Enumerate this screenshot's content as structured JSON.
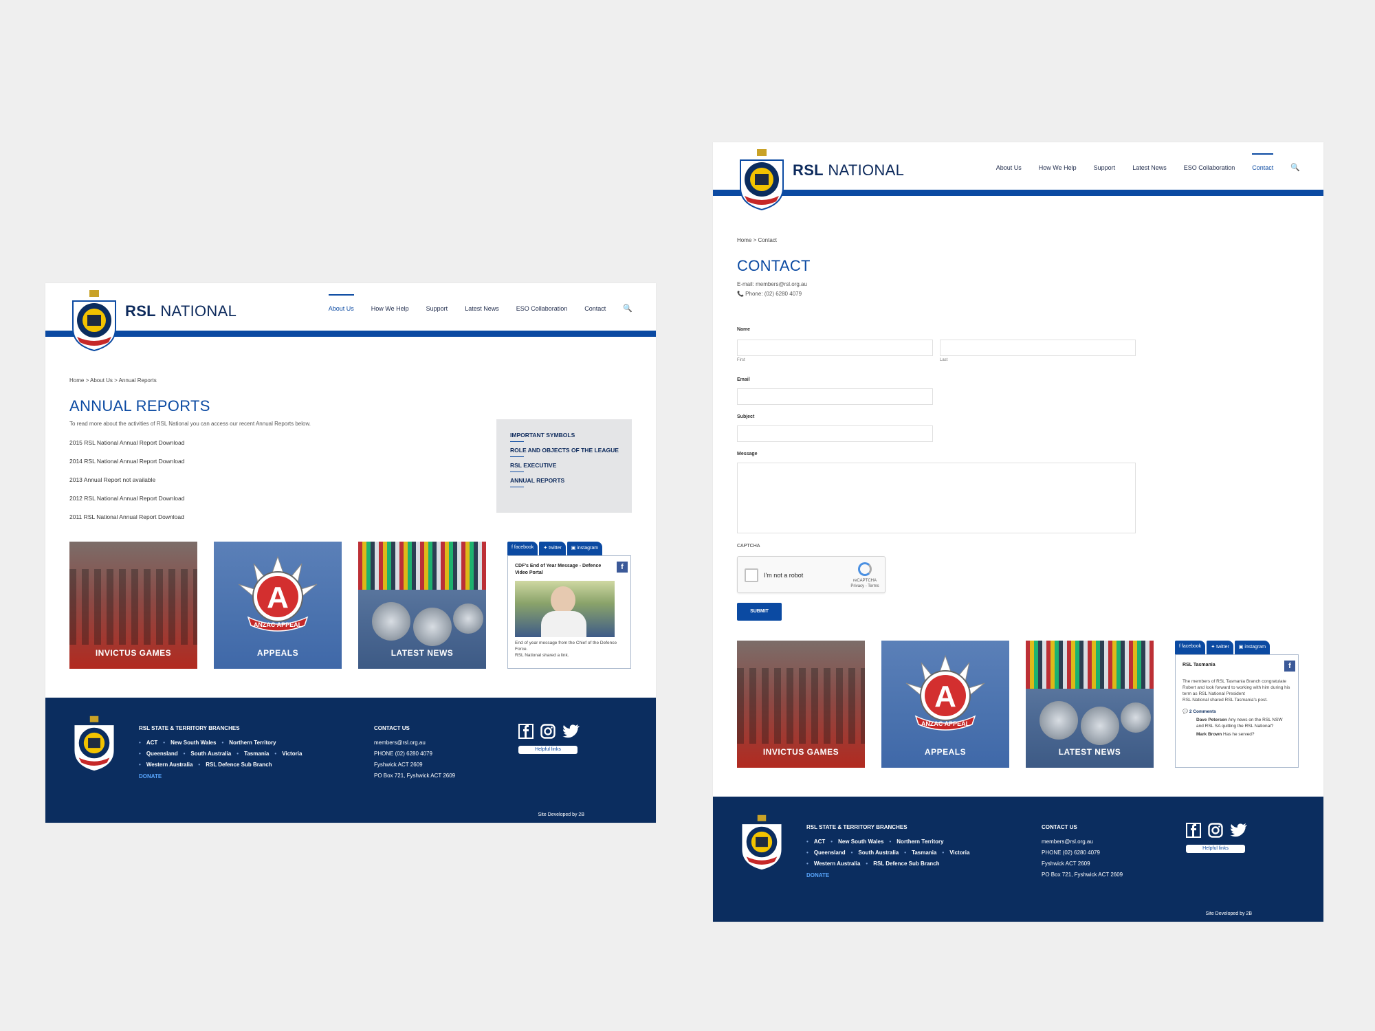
{
  "brand": {
    "bold": "RSL",
    "light": "NATIONAL"
  },
  "nav": {
    "about": "About Us",
    "help": "How We Help",
    "support": "Support",
    "news": "Latest News",
    "eso": "ESO Collaboration",
    "contact": "Contact"
  },
  "left": {
    "breadcrumb": "Home > About Us > Annual Reports",
    "title": "ANNUAL REPORTS",
    "intro": "To read more about the activities of RSL National you can access our recent Annual Reports below.",
    "reports": [
      "2015 RSL National Annual Report Download",
      "2014 RSL National Annual Report Download",
      "2013 Annual Report not available",
      "2012 RSL National Annual Report Download",
      "2011 RSL National Annual Report Download"
    ],
    "sidebar": [
      "IMPORTANT SYMBOLS",
      "ROLE AND OBJECTS OF THE LEAGUE",
      "RSL EXECUTIVE",
      "ANNUAL REPORTS"
    ],
    "social": {
      "title": "CDF's End of Year Message - Defence Video Portal",
      "text1": "End of year message from the Chief of the Defence Force.",
      "text2": "RSL National shared a link."
    }
  },
  "right": {
    "breadcrumb": "Home > Contact",
    "title": "CONTACT",
    "email": "E-mail: members@rsl.org.au",
    "phone": "📞 Phone: (02) 6280 4079",
    "form": {
      "name": "Name",
      "first": "First",
      "last": "Last",
      "email": "Email",
      "subject": "Subject",
      "message": "Message",
      "captcha": "CAPTCHA",
      "robot": "I'm not a robot",
      "recaptcha": "reCAPTCHA",
      "privacy": "Privacy - Terms",
      "submit": "SUBMIT"
    },
    "social": {
      "title": "RSL Tasmania",
      "text": "The members of RSL Tasmania Branch congratulate Robert and look forward to working with him during his term as RSL National President",
      "shared": "RSL National shared RSL Tasmania's post.",
      "comments": "2 Comments",
      "c1_name": "Dave Petersen",
      "c1_text": "Any news on the RSL NSW and RSL SA quitting the RSL National?",
      "c2_name": "Mark Brown",
      "c2_text": "Has he served?"
    }
  },
  "tiles": {
    "invictus": "INVICTUS GAMES",
    "appeals": "APPEALS",
    "news": "LATEST NEWS",
    "anzac": "ANZAC APPEAL"
  },
  "social_tabs": {
    "facebook": "facebook",
    "twitter": "twitter",
    "instagram": "instagram"
  },
  "footer": {
    "branches_title": "RSL STATE & TERRITORY BRANCHES",
    "row1": [
      "ACT",
      "New South Wales",
      "Northern Territory"
    ],
    "row2": [
      "Queensland",
      "South Australia",
      "Tasmania",
      "Victoria"
    ],
    "row3": [
      "Western Australia",
      "RSL Defence Sub Branch"
    ],
    "donate": "DONATE",
    "contact_title": "CONTACT US",
    "email": "members@rsl.org.au",
    "phone": "PHONE (02) 6280 4079",
    "city": "Fyshwick ACT 2609",
    "po": "PO Box 721, Fyshwick ACT 2609",
    "helpful": "Helpful links",
    "dev": "Site Developed by 2B"
  },
  "colors": {
    "brand_blue": "#0b4aa2",
    "footer_navy": "#0b2d5f",
    "accent_red": "#b22a20"
  }
}
